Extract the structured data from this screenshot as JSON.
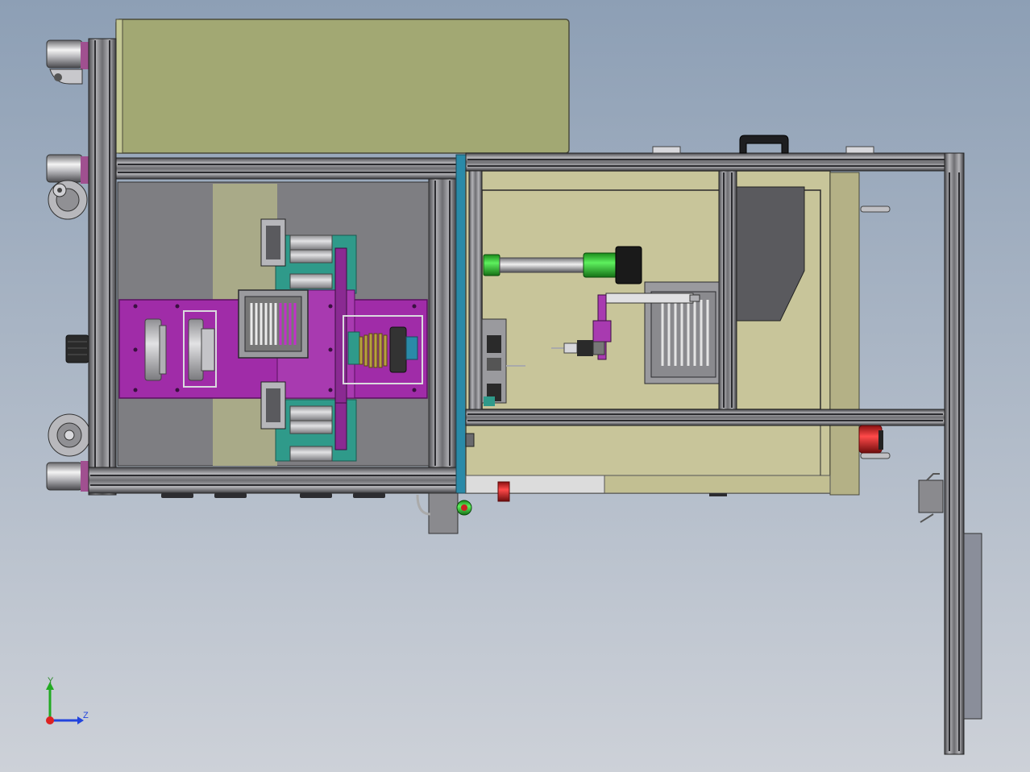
{
  "triad": {
    "y_label": "Y",
    "z_label": "Z"
  },
  "colors": {
    "background_top": "#8ea0b6",
    "background_bottom": "#c9ced6",
    "enclosure_khaki": "#a2a873",
    "panel_tan": "#c8c59a",
    "plate_magenta": "#a02ca8",
    "bracket_teal": "#2f9a8a",
    "frame_grey": "#9a9aa0",
    "frame_dark": "#3a3a3e",
    "motor_green": "#33cc33",
    "emergency_red": "#d41c1c",
    "rail_blue": "#2a8aa8",
    "axis_y_green": "#22aa22",
    "axis_z_blue": "#2244dd",
    "axis_origin_red": "#dd2222"
  }
}
